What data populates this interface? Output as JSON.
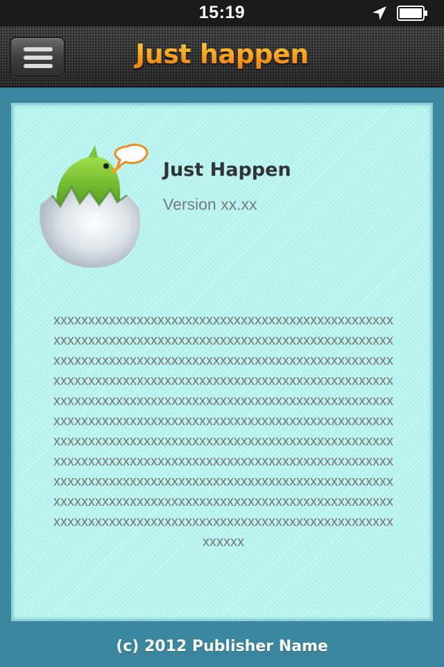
{
  "status_bar": {
    "time": "15:19",
    "icons": [
      "location-icon",
      "battery-icon"
    ]
  },
  "nav_bar": {
    "title": "Just happen",
    "menu_icon": "menu-icon",
    "title_colors": [
      "#ffd23c",
      "#ef7d12"
    ]
  },
  "about": {
    "app_icon": "egg-bird-icon",
    "app_name": "Just Happen",
    "version": "Version xx.xx",
    "description": "xxxxxxxxxxxxxxxxxxxxxxxxxxxxxxxxxxxxxxxxxxxxxxxxxxxxxxxxxxxxxxxxxxxxxxxxxxxxxxxxxxxxxxxxxxxxxxxxxxxxxxxxxxxxxxxxxxxxxxxxxxxxxxxxxxxxxxxxxxxxxxxxxxxxxxxxxxxxxxxxxxxxxxxxxxxxxxxxxxxxxxxxxxxxxxxxxxxxxxxxxxxxxxxxxxxxxxxxxxxxxxxxxxxxxxxxxxxxxxxxxxxxxxxxxxxxxxxxxxxxxxxxxxxxxxxxxxxxxxxxxxxxxxxxxxxxxxxxxxxxxxxxxxxxxxxxxxxxxxxxxxxxxxxxxxxxxxxxxxxxxxxxxxxxxxxxxxxxxxxxxxxxxxxxxxxxxxxxxxxxxxxxxxxxxxxxxxxxxxxxxxxxxxxxxxxxxxxxxxxxxxxxxxxxxxxxxxxxxxxxxxxxxxxxxxxxxxxxxxxxxxxxxxxxxxxxxxxxxxxxxxxxxxxxxxxxxxxxxxxxxxxxxxxxxxxxxxxxxxxxxxxxxxxxxxxxxxxxxxxxxxxxx"
  },
  "footer": {
    "copyright": "(c) 2012 Publisher Name"
  },
  "colors": {
    "background": "#3a869e",
    "panel": "#bff6f1",
    "status_bar": "#1a1a1a",
    "nav_bar": "#3a3a3a",
    "footer_text": "#ffffff"
  }
}
